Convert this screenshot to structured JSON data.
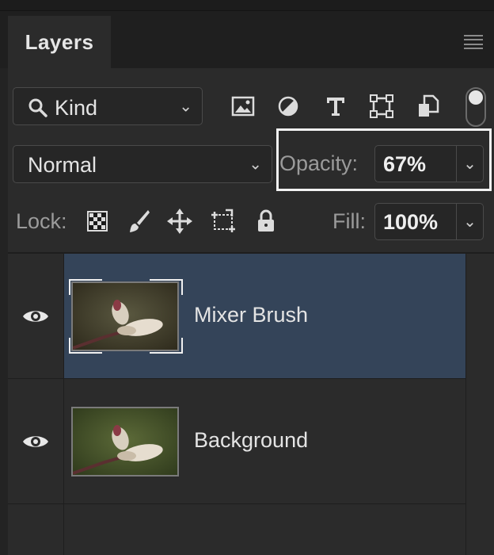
{
  "panel": {
    "tab_label": "Layers",
    "menu_icon": "panel-menu-icon"
  },
  "filter": {
    "kind_label": "Kind",
    "icons": [
      "pixel-layer-filter-icon",
      "adjustment-layer-filter-icon",
      "type-layer-filter-icon",
      "shape-layer-filter-icon",
      "smart-object-filter-icon"
    ],
    "toggle_on": true
  },
  "blend": {
    "mode": "Normal",
    "opacity_label": "Opacity:",
    "opacity_value": "67%"
  },
  "lock": {
    "label": "Lock:",
    "icons": [
      "lock-transparent-pixels-icon",
      "lock-image-pixels-icon",
      "lock-position-icon",
      "lock-artboard-icon",
      "lock-all-icon"
    ],
    "fill_label": "Fill:",
    "fill_value": "100%"
  },
  "layers": [
    {
      "name": "Mixer Brush",
      "selected": true,
      "visible": true
    },
    {
      "name": "Background",
      "selected": false,
      "visible": true
    }
  ],
  "colors": {
    "panel_bg": "#2b2b2b",
    "selected_row": "#344459",
    "highlight_box": "#f2f2f2"
  }
}
